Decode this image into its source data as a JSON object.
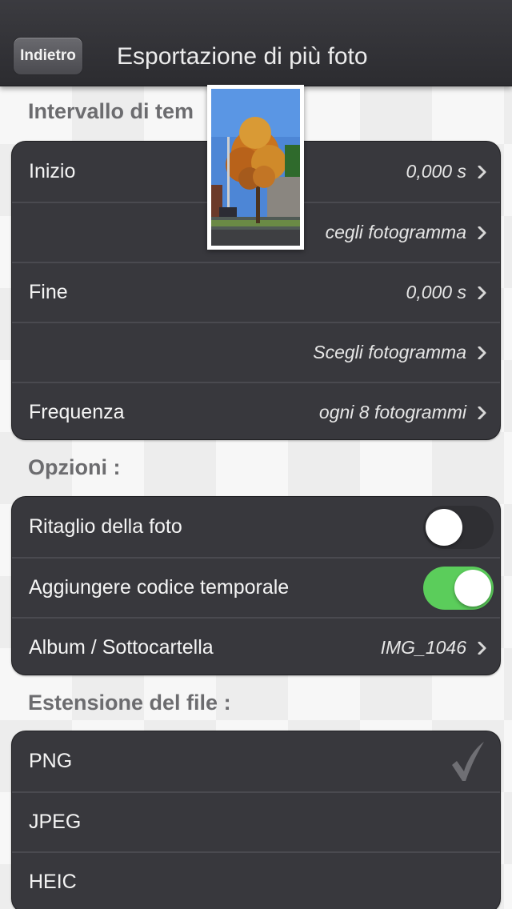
{
  "nav": {
    "back_label": "Indietro",
    "title": "Esportazione di più foto"
  },
  "sections": {
    "interval_header": "Intervallo di tem",
    "options_header": "Opzioni :",
    "extension_header": "Estensione del file :"
  },
  "interval": {
    "start_label": "Inizio",
    "start_value": "0,000 s",
    "start_frame_value": "cegli fotogramma",
    "end_label": "Fine",
    "end_value": "0,000 s",
    "end_frame_value": "Scegli fotogramma",
    "frequency_label": "Frequenza",
    "frequency_value": "ogni 8 fotogrammi"
  },
  "options": {
    "crop_label": "Ritaglio della foto",
    "crop_enabled": false,
    "timecode_label": "Aggiungere codice temporale",
    "timecode_enabled": true,
    "album_label": "Album / Sottocartella",
    "album_value": "IMG_1046"
  },
  "extensions": {
    "items": [
      "PNG",
      "JPEG",
      "HEIC"
    ],
    "selected": "PNG"
  },
  "colors": {
    "toggle_on": "#5bcd5b",
    "cell_background": "#38383d",
    "navbar": "#2c2c30"
  },
  "icons": {
    "chevron": "chevron-right-icon",
    "check": "checkmark-icon"
  }
}
